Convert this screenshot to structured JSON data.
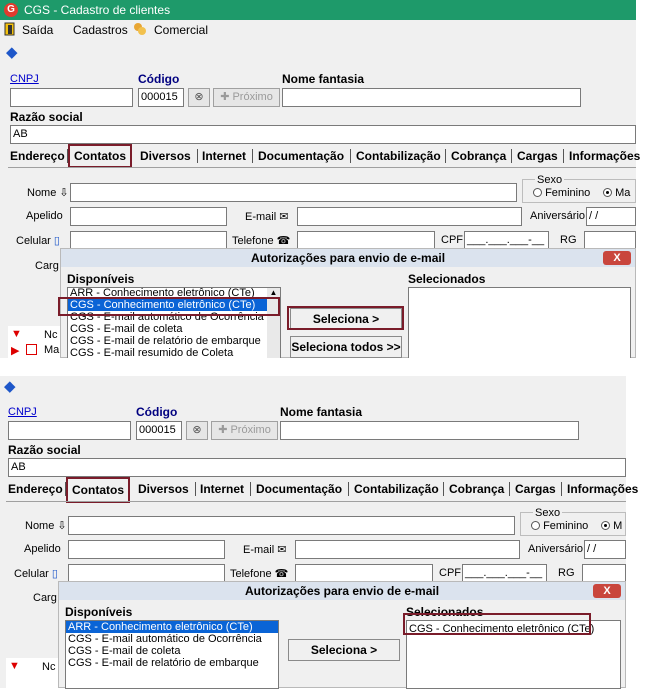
{
  "window": {
    "title": "CGS - Cadastro de clientes"
  },
  "menu": {
    "exit": "Saída",
    "registers": "Cadastros",
    "commercial": "Comercial"
  },
  "form": {
    "cnpj_label": "CNPJ",
    "code_label": "Código",
    "code_value": "000015",
    "next_label": "Próximo",
    "trade_name_label": "Nome fantasia",
    "company_name_label": "Razão social",
    "company_name_value": "AB"
  },
  "tabs": [
    "Endereço",
    "Contatos",
    "Diversos",
    "Internet",
    "Documentação",
    "Contabilização",
    "Cobrança",
    "Cargas",
    "Informações"
  ],
  "contacts": {
    "name_label": "Nome",
    "sex_label": "Sexo",
    "female_label": "Feminino",
    "male_label_top": "Ma",
    "male_label_bottom": "M",
    "nickname_label": "Apelido",
    "email_label": "E-mail",
    "birthday_label": "Aniversário",
    "birthday_value": "/ /",
    "mobile_label": "Celular",
    "phone_label": "Telefone",
    "cpf_label": "CPF",
    "cpf_value": "___.___.___-__",
    "rg_label": "RG",
    "role_label": "Carg"
  },
  "grid": {
    "col_label": "Nc",
    "row_prefix": "Ma"
  },
  "dialog": {
    "title": "Autorizações para envio de e-mail",
    "available_label": "Disponíveis",
    "selected_label": "Selecionados",
    "select_button": "Seleciona >",
    "select_all_button": "Seleciona todos >>",
    "close": "X",
    "available_top": [
      "ARR - Conhecimento eletrônico (CTe)",
      "CGS - Conhecimento eletrônico (CTe)",
      "CGS - E-mail automático de Ocorrência",
      "CGS - E-mail de coleta",
      "CGS - E-mail de relatório de embarque",
      "CGS - E-mail resumido de Coleta"
    ],
    "available_bottom": [
      "ARR - Conhecimento eletrônico (CTe)",
      "CGS - E-mail automático de Ocorrência",
      "CGS - E-mail de coleta",
      "CGS - E-mail de relatório de embarque"
    ],
    "selected_bottom": [
      "CGS - Conhecimento eletrônico (CTe)"
    ]
  },
  "colors": {
    "title_bar": "#1e9a6a",
    "highlight_border": "#7a1c2a",
    "selection": "#0a64d6"
  }
}
